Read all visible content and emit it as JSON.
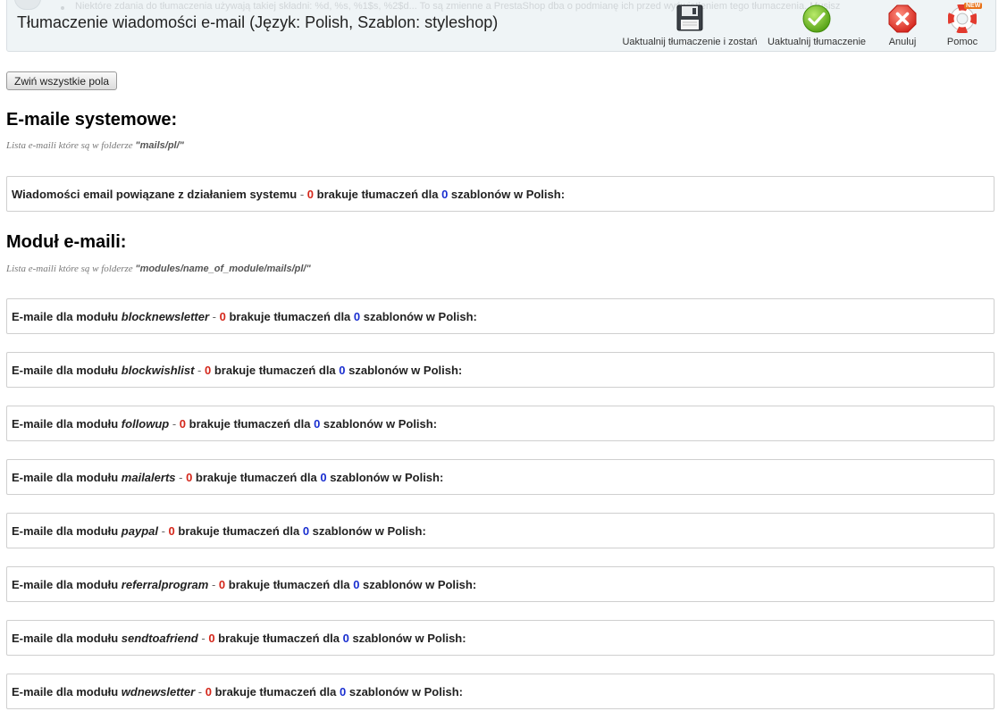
{
  "toolbar": {
    "title": "Tłumaczenie wiadomości e-mail (Język: Polish, Szablon: styleshop)",
    "background_note": "Niektóre zdania do tłumaczenia używają takiej składni: %d, %s, %1$s, %2$d... To są zmienne a PrestaShop dba o podmianę ich przed wyświetleniem tego tłumaczenia. Musisz",
    "buttons": [
      {
        "label": "Uaktualnij tłumaczenie i zostań",
        "icon": "save-disk-icon"
      },
      {
        "label": "Uaktualnij tłumaczenie",
        "icon": "check-icon"
      },
      {
        "label": "Anuluj",
        "icon": "cancel-icon"
      },
      {
        "label": "Pomoc",
        "icon": "help-lifebuoy-icon",
        "badge": "NEW"
      }
    ]
  },
  "collapse_button": "Zwiń wszystkie pola",
  "system": {
    "heading": "E-maile systemowe:",
    "hint_prefix": "Lista e-maili które są w folderze",
    "hint_folder": "\"mails/pl/\"",
    "box": {
      "prefix": "Wiadomości email powiązane z działaniem systemu",
      "dash": " - ",
      "missing": "0",
      "middle": " brakuje tłumaczeń dla ",
      "templates": "0",
      "suffix": " szablonów w Polish:"
    }
  },
  "modules": {
    "heading": "Moduł e-maili:",
    "hint_prefix": "Lista e-maili które są w folderze",
    "hint_folder": "\"modules/name_of_module/mails/pl/\"",
    "common": {
      "prefix": "E-maile dla modułu ",
      "dash": " - ",
      "middle": " brakuje tłumaczeń dla ",
      "suffix": " szablonów w Polish:"
    },
    "items": [
      {
        "module": "blocknewsletter",
        "missing": "0",
        "templates": "0"
      },
      {
        "module": "blockwishlist",
        "missing": "0",
        "templates": "0"
      },
      {
        "module": "followup",
        "missing": "0",
        "templates": "0"
      },
      {
        "module": "mailalerts",
        "missing": "0",
        "templates": "0"
      },
      {
        "module": "paypal",
        "missing": "0",
        "templates": "0"
      },
      {
        "module": "referralprogram",
        "missing": "0",
        "templates": "0"
      },
      {
        "module": "sendtoafriend",
        "missing": "0",
        "templates": "0"
      },
      {
        "module": "wdnewsletter",
        "missing": "0",
        "templates": "0"
      }
    ]
  },
  "colors": {
    "missing_count": "#d4271b",
    "template_count": "#1a2fd0",
    "toolbar_bg": "#eff4f6"
  }
}
